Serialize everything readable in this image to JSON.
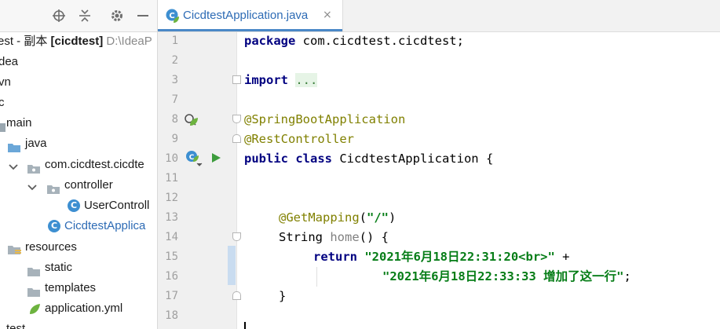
{
  "project_panel": {
    "toolbar_icons": [
      "locate-icon",
      "collapse-icon",
      "gear-icon",
      "minimize-icon"
    ],
    "tree": [
      {
        "label": "est - 副本 [cicdtest]",
        "path_hint": "D:\\IdeaP",
        "type": "project"
      },
      {
        "label": "dea",
        "type": "folder"
      },
      {
        "label": "vn",
        "type": "folder"
      },
      {
        "label": "c",
        "type": "folder"
      },
      {
        "label": "main",
        "type": "folder"
      },
      {
        "label": "java",
        "type": "source-folder"
      },
      {
        "label": "com.cicdtest.cicdte",
        "type": "package"
      },
      {
        "label": "controller",
        "type": "package"
      },
      {
        "label": "UserControll",
        "type": "class"
      },
      {
        "label": "CicdtestApplica",
        "type": "spring-class"
      },
      {
        "label": "resources",
        "type": "resources-folder"
      },
      {
        "label": "static",
        "type": "folder"
      },
      {
        "label": "templates",
        "type": "folder"
      },
      {
        "label": "application.yml",
        "type": "yml"
      },
      {
        "label": "test",
        "type": "folder"
      }
    ]
  },
  "editor": {
    "tab": {
      "label": "CicdtestApplication.java",
      "close": "×"
    },
    "line_numbers": [
      "1",
      "2",
      "3",
      "7",
      "8",
      "9",
      "10",
      "11",
      "12",
      "13",
      "14",
      "15",
      "16",
      "17",
      "18"
    ],
    "code": {
      "l1_kw": "package",
      "l1_rest": " com.cicdtest.cicdtest;",
      "l3_kw": "import",
      "l3_rest": "...",
      "l8_anno": "@SpringBootApplication",
      "l9_anno": "@RestController",
      "l10_kw": "public class",
      "l10_rest": " CicdtestApplication {",
      "l13_anno": "@GetMapping",
      "l13_open": "(",
      "l13_str": "\"/\"",
      "l13_close": ")",
      "l14_type": "String ",
      "l14_name": "home",
      "l14_rest": "() {",
      "l15_kw": "return",
      "l15_str": "\"2021年6月18日22:31:20<br>\"",
      "l15_rest": " +",
      "l16_str": "\"2021年6月18日22:33:33 增加了这一行\"",
      "l16_rest": ";",
      "l17": "}"
    }
  }
}
